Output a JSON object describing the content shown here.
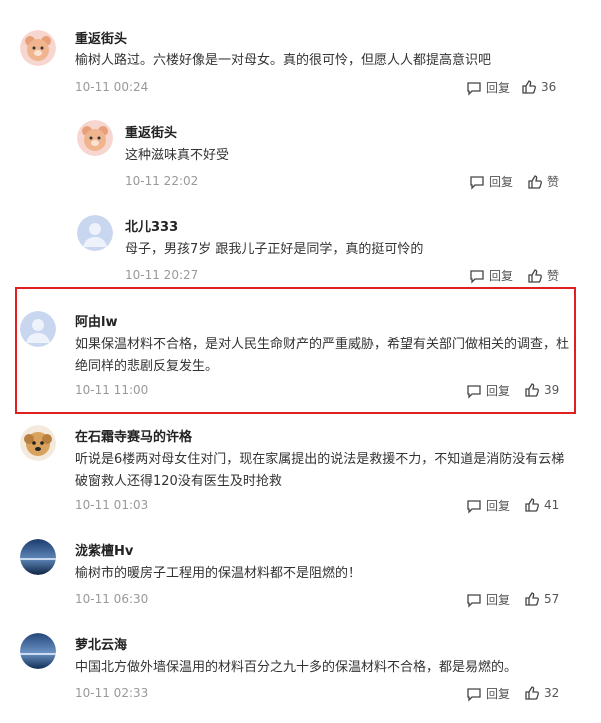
{
  "comments": [
    {
      "name": "重返街头",
      "text": "榆树人路过。六楼好像是一对母女。真的很可怜，但愿人人都提高意识吧",
      "time": "10-11 00:24",
      "reply": "回复",
      "likes": "36",
      "avatar": "bear-avatar"
    },
    {
      "name": "重返街头",
      "text": "这种滋味真不好受",
      "time": "10-11 22:02",
      "reply": "回复",
      "likes": "赞",
      "avatar": "bear-avatar"
    },
    {
      "name": "北儿333",
      "text": "母子，男孩7岁 跟我儿子正好是同学，真的挺可怜的",
      "time": "10-11 20:27",
      "reply": "回复",
      "likes": "赞",
      "avatar": "default-avatar"
    },
    {
      "name": "阿由lw",
      "text_line1": "如果保温材料不合格，是对人民生命财产的严重威胁，希望有关部门做相关的调查，杜",
      "text_line2": "绝同样的悲剧反复发生。",
      "time": "10-11 11:00",
      "reply": "回复",
      "likes": "39",
      "avatar": "default-avatar"
    },
    {
      "name": "在石霜寺赛马的许格",
      "text_line1": "听说是6楼两对母女住对门，现在家属提出的说法是救援不力，不知道是消防没有云梯",
      "text_line2": "破窗救人还得120没有医生及时抢救",
      "time": "10-11 01:03",
      "reply": "回复",
      "likes": "41",
      "avatar": "dog-avatar"
    },
    {
      "name": "泷紫檀Hv",
      "text": "榆树市的暖房子工程用的保温材料都不是阻燃的！",
      "time": "10-11 06:30",
      "reply": "回复",
      "likes": "57",
      "avatar": "landscape-avatar"
    },
    {
      "name": "萝北云海",
      "text": "中国北方做外墙保温用的材料百分之九十多的保温材料不合格，都是易燃的。",
      "time": "10-11 02:33",
      "reply": "回复",
      "likes": "32",
      "avatar": "landscape-avatar"
    }
  ],
  "colors": {
    "highlight": "#e02020",
    "name": "#222222",
    "text": "#333333",
    "time": "#999999"
  }
}
